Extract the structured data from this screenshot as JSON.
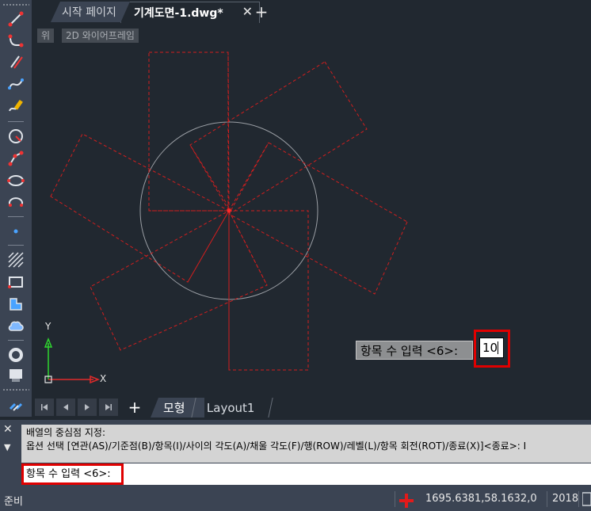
{
  "tabs": {
    "start_label": "시작 페이지",
    "drawing_label": "기계도면-1.dwg*",
    "close_glyph": "✕",
    "add_glyph": "+"
  },
  "viewport": {
    "view_label": "위",
    "style_label": "2D 와이어프레임",
    "ucs_x_label": "X",
    "ucs_y_label": "Y"
  },
  "dynamic_input": {
    "prompt_text": "항목 수 입력 <6>:",
    "value": "10"
  },
  "layout_tabs": {
    "add_glyph": "+",
    "model_label": "모형",
    "layout1_label": "Layout1"
  },
  "command": {
    "history_line1": "배열의 중심점 지정:",
    "history_line2": "옵션 선택 [연관(AS)/기준점(B)/항목(I)/사이의 각도(A)/채울 각도(F)/행(ROW)/레벨(L)/항목 회전(ROT)/종료(X)]<종료>: I",
    "current_prompt": "항목 수 입력 <6>:",
    "close_glyph": "✕",
    "menu_glyph": "▼"
  },
  "status": {
    "ready_text": "준비",
    "coordinates": "1695.6381,58.1632,0",
    "version": "2018"
  },
  "colors": {
    "background": "#212830",
    "panel": "#3b4453",
    "highlight_red": "#e00000",
    "dash_red": "#d21e1e",
    "ucs_green": "#2fd52f"
  },
  "toolbar_icons": [
    "line-icon",
    "polyline-icon",
    "multiline-icon",
    "spline-icon",
    "sketch-icon",
    "circle-icon",
    "arc-icon",
    "ellipse-icon",
    "ellipse-arc-icon",
    "point-icon",
    "hatch-icon",
    "rectangle-icon",
    "region-icon",
    "cloud-icon",
    "donut-icon",
    "wipeout-icon",
    "connect-icon"
  ]
}
